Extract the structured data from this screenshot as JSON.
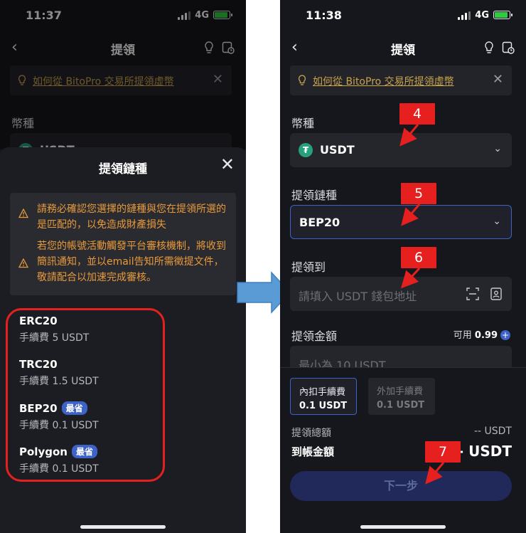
{
  "left": {
    "status": {
      "time": "11:37",
      "network": "4G"
    },
    "nav": {
      "title": "提領"
    },
    "banner": {
      "text": "如何從 BitoPro 交易所提領虛幣"
    },
    "currency_label": "幣種",
    "currency_value": "USDT",
    "sheet": {
      "title": "提領鏈種",
      "warnings": [
        "請務必確認您選擇的鏈種與您在提領所選的是匹配的，以免造成財產損失",
        "若您的帳號活動觸發平台審核機制，將收到簡訊通知，並以email告知所需徵提文件，敬請配合以加速完成審核。"
      ],
      "chains": [
        {
          "name": "ERC20",
          "fee": "手續費 5 USDT",
          "badge": ""
        },
        {
          "name": "TRC20",
          "fee": "手續費 1.5 USDT",
          "badge": ""
        },
        {
          "name": "BEP20",
          "fee": "手續費 0.1 USDT",
          "badge": "最省"
        },
        {
          "name": "Polygon",
          "fee": "手續費 0.1 USDT",
          "badge": "最省"
        }
      ]
    }
  },
  "right": {
    "status": {
      "time": "11:38",
      "network": "4G"
    },
    "nav": {
      "title": "提領"
    },
    "banner": {
      "text": "如何從 BitoPro 交易所提領虛幣"
    },
    "currency_label": "幣種",
    "currency_value": "USDT",
    "chain_label": "提領鏈種",
    "chain_value": "BEP20",
    "address_label": "提領到",
    "address_placeholder": "請填入 USDT 錢包地址",
    "amount_label": "提領金額",
    "available_label": "可用",
    "available_value": "0.99",
    "amount_placeholder": "最小為 10 USDT",
    "fee_inclusive": {
      "label": "內扣手續費",
      "value": "0.1 USDT"
    },
    "fee_exclusive": {
      "label": "外加手續費",
      "value": "0.1 USDT"
    },
    "total_label": "提領總額",
    "total_value": "-- USDT",
    "received_label": "到帳金額",
    "received_value": "-- USDT",
    "next_label": "下一步"
  },
  "annotations": {
    "markers": [
      "4",
      "5",
      "6",
      "7"
    ],
    "color": "#e5201f"
  },
  "colors": {
    "accent": "#3d63c9",
    "warning": "#e89a3a",
    "link": "#c9a24a",
    "bg": "#16171c",
    "flow_arrow": "#5b9bd5"
  }
}
